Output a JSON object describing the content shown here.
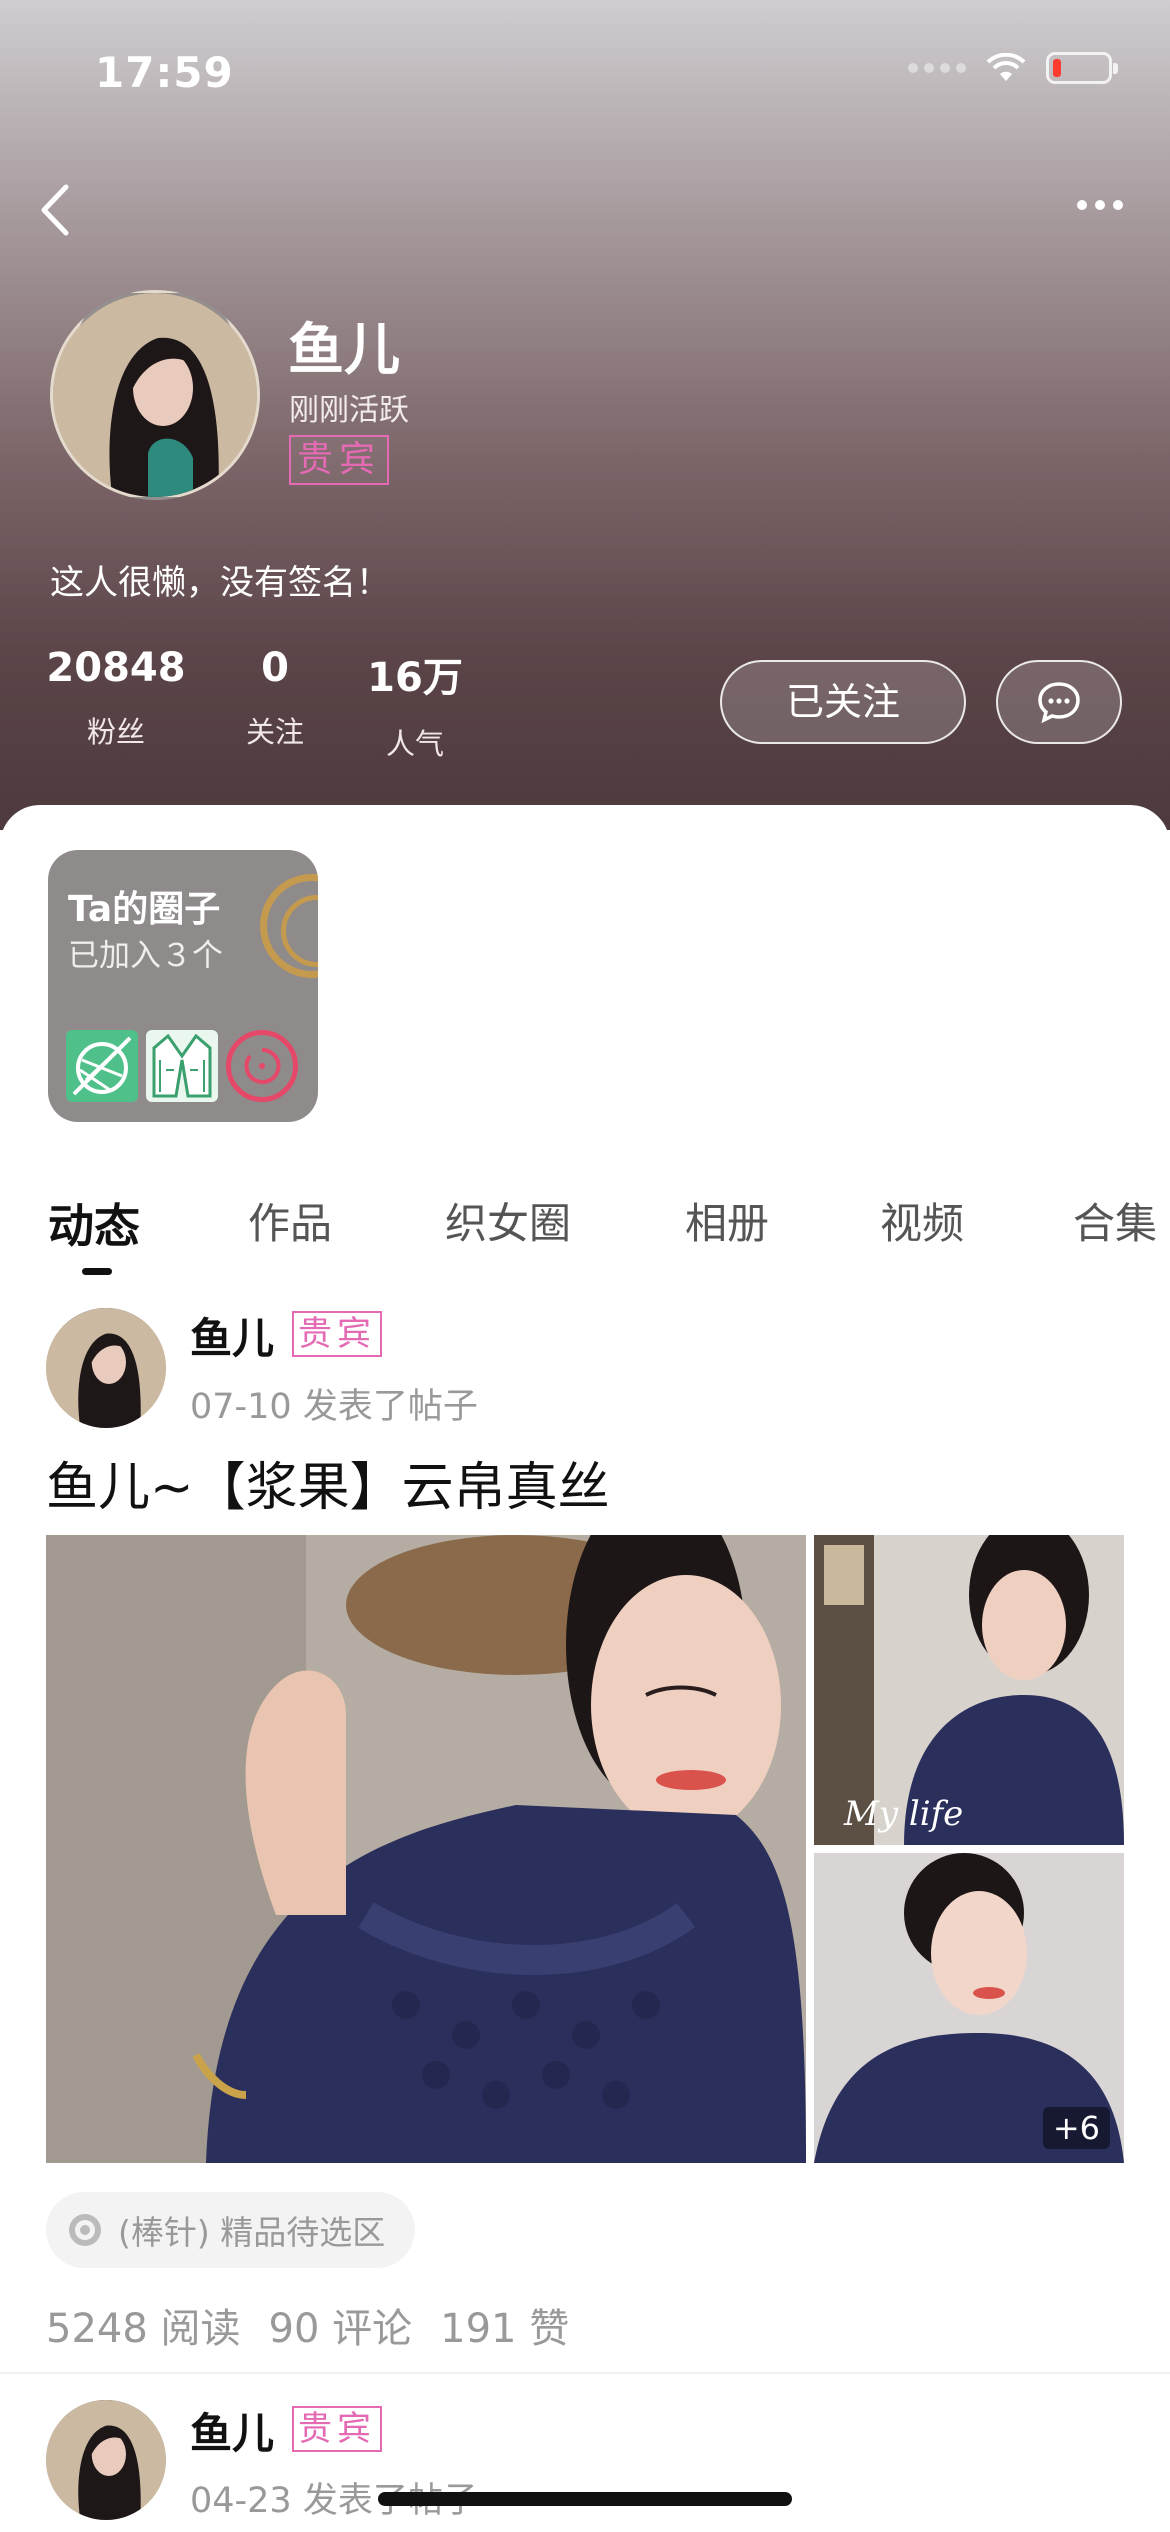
{
  "status_bar": {
    "time": "17:59",
    "icons": [
      "signal-icon",
      "wifi-icon",
      "battery-low-icon"
    ]
  },
  "nav": {
    "back_icon": "chevron-left-icon",
    "more_icon": "more-dots-icon"
  },
  "profile": {
    "name": "鱼儿",
    "activity": "刚刚活跃",
    "vip_badge": "贵宾",
    "signature": "这人很懒，没有签名！",
    "stats": [
      {
        "value": "20848",
        "label": "粉丝"
      },
      {
        "value": "0",
        "label": "关注"
      },
      {
        "value": "16万",
        "label": "人气"
      }
    ],
    "follow_button": "已关注",
    "message_icon": "chat-bubble-icon"
  },
  "circle_card": {
    "title": "Ta的圈子",
    "subtitle": "已加入３个"
  },
  "tabs": [
    {
      "label": "动态",
      "active": true
    },
    {
      "label": "作品"
    },
    {
      "label": "织女圈"
    },
    {
      "label": "相册"
    },
    {
      "label": "视频"
    },
    {
      "label": "合集"
    }
  ],
  "posts": [
    {
      "author": "鱼儿",
      "vip_badge": "贵宾",
      "meta": "07-10 发表了帖子",
      "title": "鱼儿~【浆果】云帛真丝",
      "more_images": "+6",
      "image_caption": "My life",
      "tag": "(棒针) 精品待选区",
      "stats": {
        "reads": "5248 阅读",
        "comments": "90 评论",
        "likes": "191 赞"
      }
    },
    {
      "author": "鱼儿",
      "vip_badge": "贵宾",
      "meta": "04-23 发表了帖子"
    }
  ],
  "colors": {
    "vip": "#e46ab4",
    "accent_ring": "#c49a4e",
    "knit_green": "#4fc089",
    "red_ring": "#e54868"
  }
}
